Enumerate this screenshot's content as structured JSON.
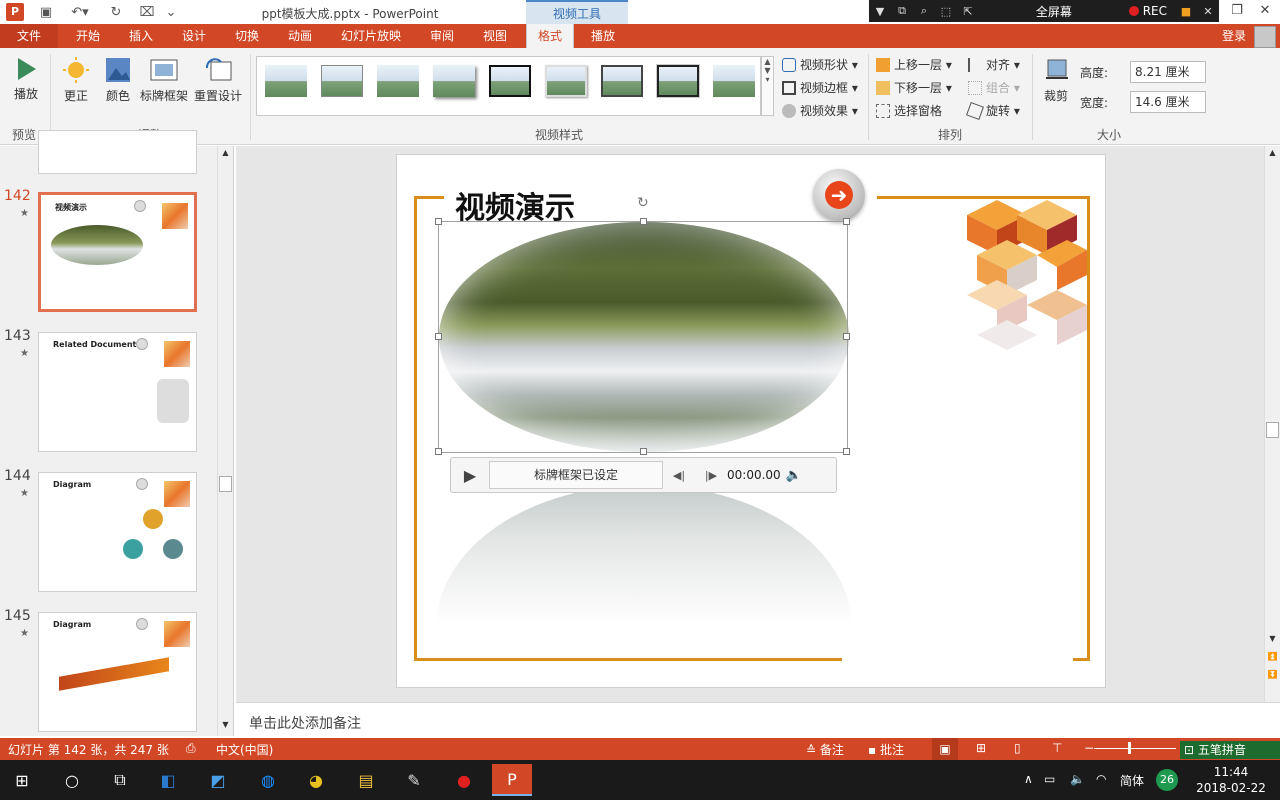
{
  "window": {
    "title": "ppt模板大成.pptx - PowerPoint",
    "video_tools": "视频工具",
    "fullscreen": "全屏幕",
    "rec": "REC"
  },
  "tabs": [
    "文件",
    "开始",
    "插入",
    "设计",
    "切换",
    "动画",
    "幻灯片放映",
    "审阅",
    "视图",
    "格式",
    "播放"
  ],
  "active_tab": "格式",
  "login": "登录",
  "ribbon": {
    "preview": {
      "play": "播放",
      "group": "预览"
    },
    "adjust": {
      "correct": "更正",
      "color": "颜色",
      "poster_frame": "标牌框架",
      "reset_design": "重置设计",
      "group": "调整"
    },
    "video_styles": {
      "group": "视频样式",
      "shape": "视频形状",
      "border": "视频边框",
      "effects": "视频效果"
    },
    "arrange": {
      "group": "排列",
      "bring_forward": "上移一层",
      "send_backward": "下移一层",
      "selection_pane": "选择窗格",
      "align": "对齐",
      "group_btn": "组合",
      "rotate": "旋转"
    },
    "size": {
      "group": "大小",
      "crop": "裁剪",
      "height_label": "高度:",
      "height_value": "8.21 厘米",
      "width_label": "宽度:",
      "width_value": "14.6 厘米"
    }
  },
  "slides": [
    {
      "num": "142",
      "title": "视频演示"
    },
    {
      "num": "143",
      "title": "Related Documents"
    },
    {
      "num": "144",
      "title": "Diagram"
    },
    {
      "num": "145",
      "title": "Diagram"
    }
  ],
  "slide": {
    "title": "视频演示",
    "player_label": "标牌框架已设定",
    "player_time": "00:00.00"
  },
  "notes_placeholder": "单击此处添加备注",
  "status": {
    "slide_info": "幻灯片 第 142 张，共 247 张",
    "language": "中文(中国)",
    "notes": "备注",
    "comments": "批注",
    "ime": "五笔拼音"
  },
  "taskbar": {
    "time": "11:44",
    "date": "2018-02-22",
    "ime": "简体",
    "badge": "26"
  }
}
